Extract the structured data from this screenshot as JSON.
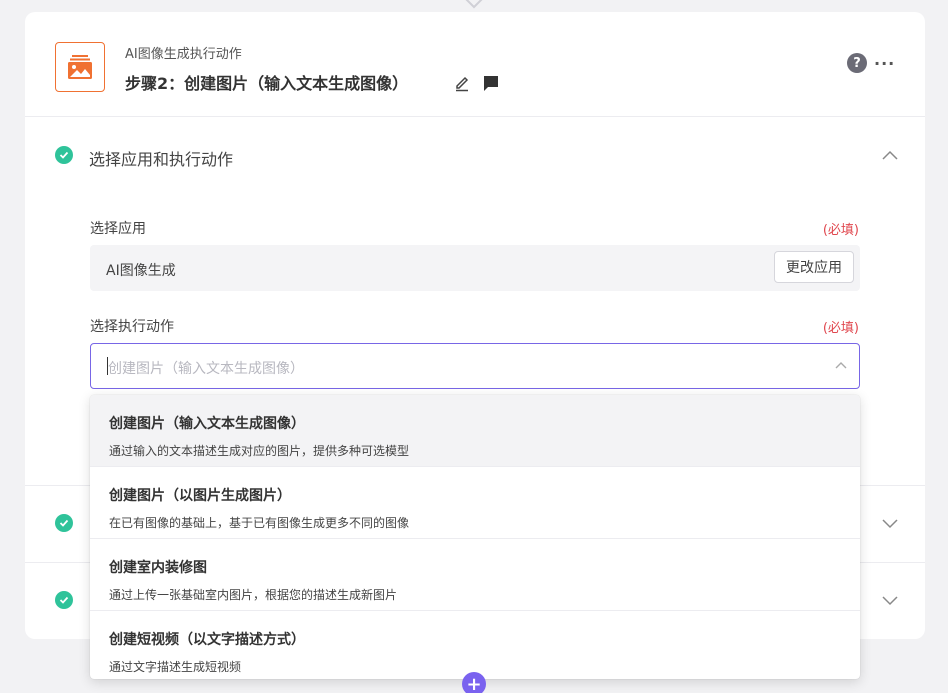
{
  "header": {
    "subtitle": "AI图像生成执行动作",
    "title": "步骤2：创建图片（输入文本生成图像）",
    "help_icon": "?",
    "more_icon": "···",
    "logo_color": "#f07132"
  },
  "section_app_action": {
    "title": "选择应用和执行动作",
    "app_label": "选择应用",
    "app_required": "(必填)",
    "app_value": "AI图像生成",
    "change_app_button": "更改应用",
    "action_label": "选择执行动作",
    "action_required": "(必填)",
    "action_placeholder": "创建图片（输入文本生成图像）"
  },
  "dropdown": {
    "options": [
      {
        "title": "创建图片（输入文本生成图像）",
        "desc": "通过输入的文本描述生成对应的图片，提供多种可选模型"
      },
      {
        "title": "创建图片（以图片生成图片）",
        "desc": "在已有图像的基础上，基于已有图像生成更多不同的图像"
      },
      {
        "title": "创建室内装修图",
        "desc": "通过上传一张基础室内图片，根据您的描述生成新图片"
      },
      {
        "title": "创建短视频（以文字描述方式）",
        "desc": "通过文字描述生成短视频"
      }
    ]
  },
  "colors": {
    "accent": "#7a62ef",
    "success": "#2fc39a",
    "required": "#e0484f"
  },
  "add_button": "+"
}
